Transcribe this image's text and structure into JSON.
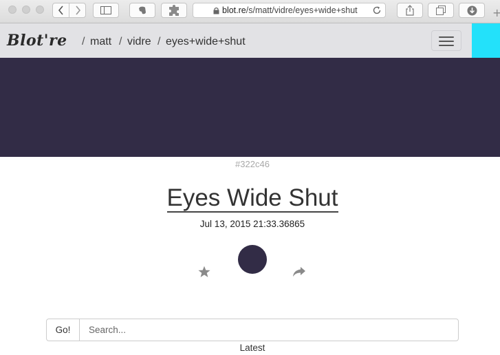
{
  "browser": {
    "url_host": "blot.re",
    "url_path": "/s/matt/vidre/eyes+wide+shut",
    "new_tab_glyph": "+",
    "icons": [
      "back-icon",
      "forward-icon",
      "sidebar-icon",
      "evernote-icon",
      "puzzle-icon",
      "lock-icon",
      "reload-icon",
      "share-icon",
      "tabs-icon",
      "download-icon"
    ]
  },
  "navbar": {
    "brand": "Blot're",
    "separator": "/",
    "breadcrumbs": [
      "matt",
      "vidre",
      "eyes+wide+shut"
    ],
    "accent_color": "#23e1fa"
  },
  "status": {
    "color_hex": "#322c46",
    "title": "Eyes Wide Shut",
    "date": "Jul 13, 2015 21:33.36865"
  },
  "search": {
    "button_label": "Go!",
    "placeholder": "Search..."
  },
  "footer": {
    "latest_label": "Latest"
  }
}
